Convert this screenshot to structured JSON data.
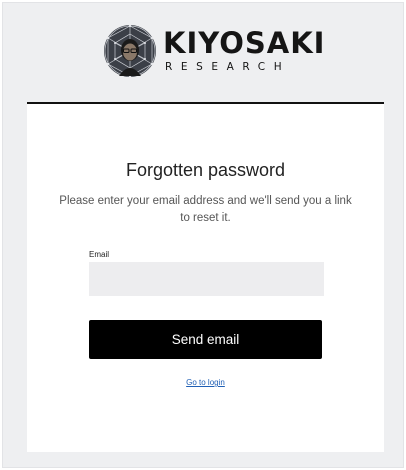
{
  "brand": {
    "name": "KIYOSAKI",
    "subtitle": "RESEARCH",
    "logo_icon": "geodesic-globe-portrait-icon"
  },
  "form": {
    "title": "Forgotten password",
    "description": "Please enter your email address and we'll send you a link to reset it.",
    "email_label": "Email",
    "email_value": "",
    "email_placeholder": "",
    "submit_label": "Send email",
    "login_link": "Go to login"
  },
  "colors": {
    "background": "#eeeff1",
    "card": "#ffffff",
    "button": "#000000",
    "link": "#1f5fb5",
    "input": "#ededef"
  }
}
